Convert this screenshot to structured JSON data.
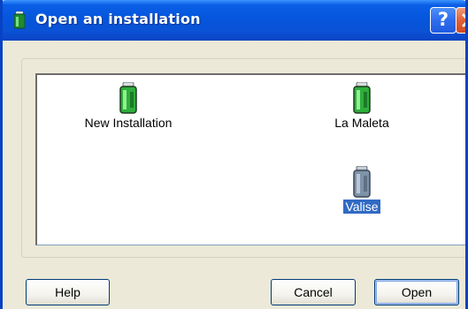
{
  "window": {
    "title": "Open an installation",
    "help_glyph": "?"
  },
  "icons": {
    "title": "installation-jar-icon",
    "help": "help-icon",
    "close": "close-icon",
    "item": "installation-jar-icon"
  },
  "installations": [
    {
      "label": "New Installation",
      "selected": false,
      "icon_style": "green"
    },
    {
      "label": "La Maleta",
      "selected": false,
      "icon_style": "green"
    },
    {
      "label": "Valise",
      "selected": true,
      "icon_style": "gray"
    }
  ],
  "buttons": {
    "help": "Help",
    "cancel": "Cancel",
    "open": "Open"
  },
  "colors": {
    "titlebar": "#0556dc",
    "dialog_face": "#ece9d8",
    "selection": "#316ac5",
    "jar_green": "#2fae3c",
    "jar_gray": "#7f93a8"
  }
}
